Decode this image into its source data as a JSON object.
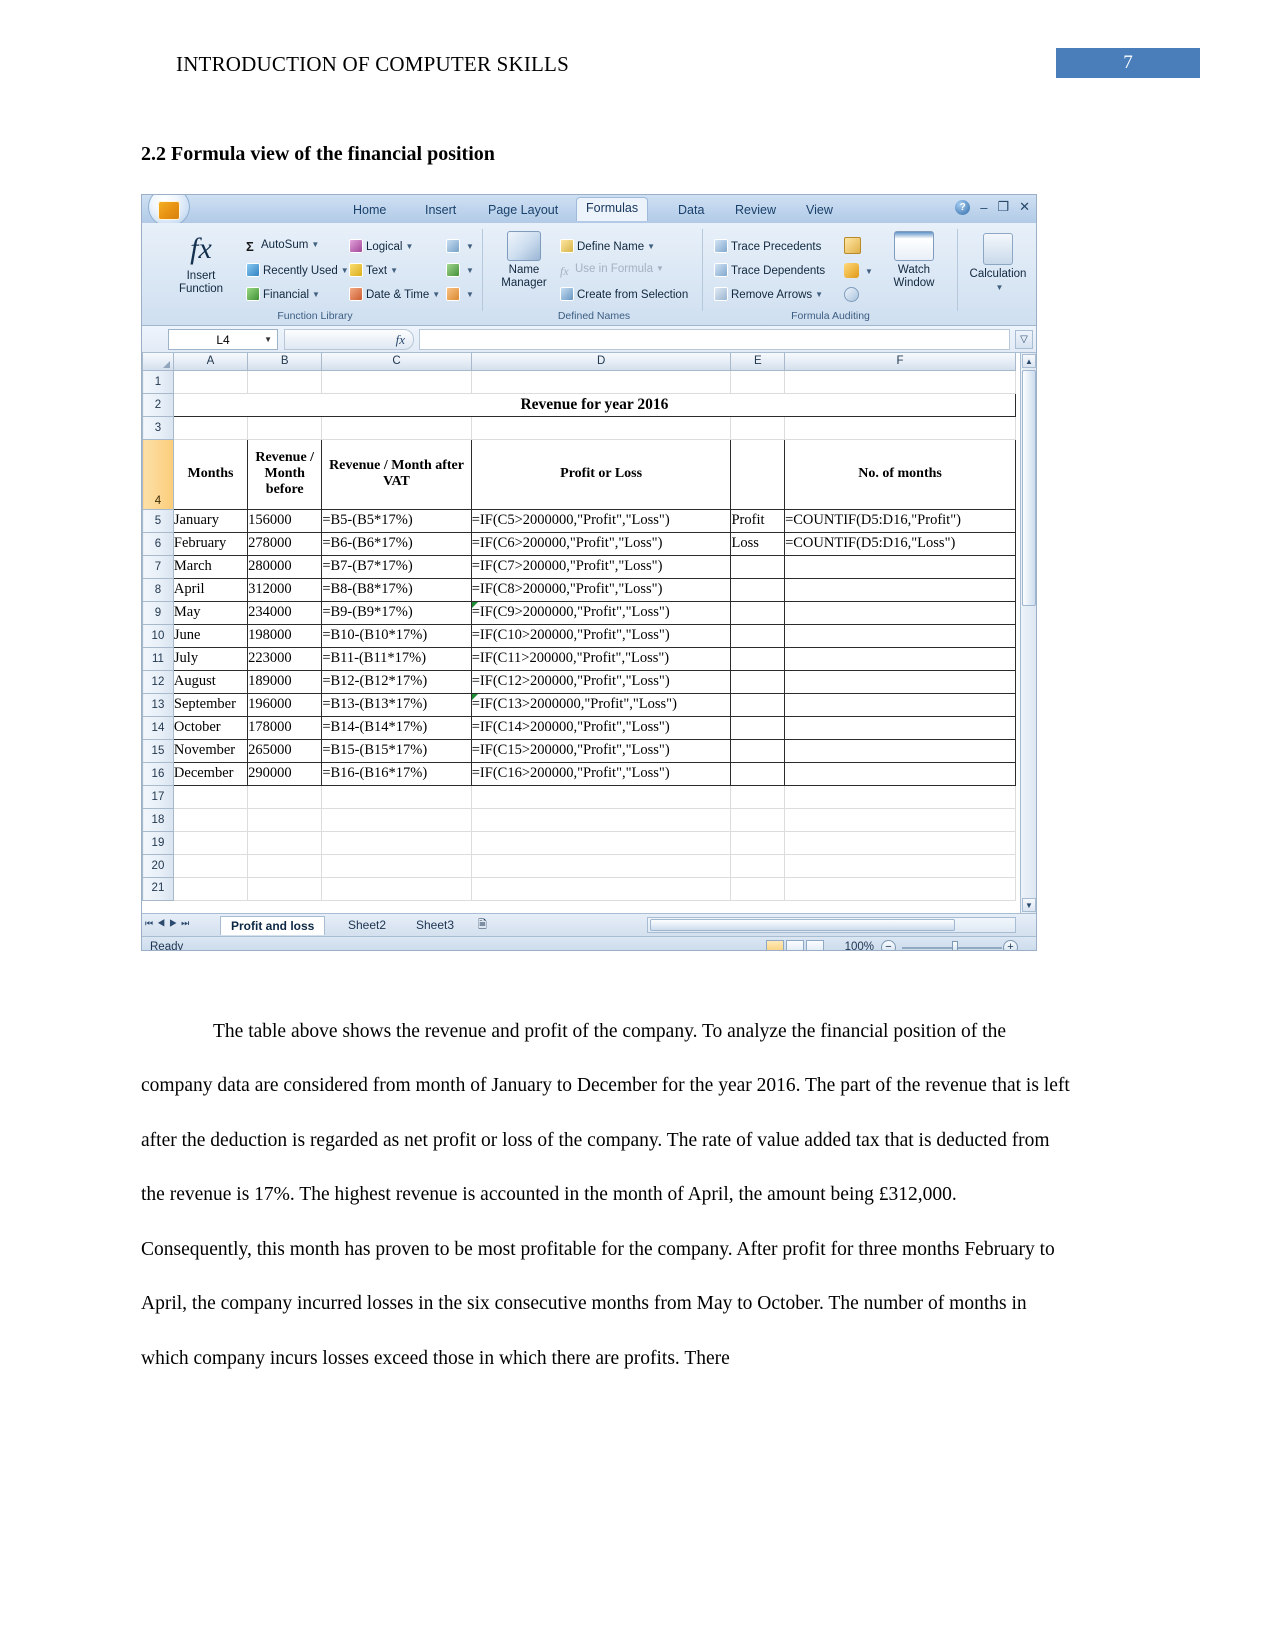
{
  "header": {
    "title": "INTRODUCTION OF COMPUTER SKILLS",
    "page_number": "7",
    "accent_color": "#4a7ebb"
  },
  "section": {
    "heading": "2.2 Formula view of the financial position"
  },
  "excel": {
    "ribbon_tabs": [
      {
        "label": "Home",
        "active": false
      },
      {
        "label": "Insert",
        "active": false
      },
      {
        "label": "Page Layout",
        "active": false
      },
      {
        "label": "Formulas",
        "active": true
      },
      {
        "label": "Data",
        "active": false
      },
      {
        "label": "Review",
        "active": false
      },
      {
        "label": "View",
        "active": false
      }
    ],
    "window_controls": {
      "help": "?",
      "minimize": "–",
      "restore": "❐",
      "close": "✕"
    },
    "groups": {
      "function_library": {
        "title": "Function Library",
        "insert_function": "Insert\nFunction",
        "insert_function_line1": "Insert",
        "insert_function_line2": "Function",
        "commands": [
          "AutoSum",
          "Recently Used",
          "Financial",
          "Logical",
          "Text",
          "Date & Time"
        ]
      },
      "defined_names": {
        "title": "Defined Names",
        "name_manager_line1": "Name",
        "name_manager_line2": "Manager",
        "commands": [
          "Define Name",
          "Use in Formula",
          "Create from Selection"
        ]
      },
      "formula_auditing": {
        "title": "Formula Auditing",
        "commands": [
          "Trace Precedents",
          "Trace Dependents",
          "Remove Arrows"
        ],
        "watch_window_line1": "Watch",
        "watch_window_line2": "Window"
      },
      "calculation": {
        "title": "",
        "label": "Calculation"
      }
    },
    "formula_bar": {
      "name_box": "L4",
      "fx_glyph": "fx",
      "value": ""
    },
    "column_headers": [
      "A",
      "B",
      "C",
      "D",
      "E",
      "F"
    ],
    "row_numbers": [
      "1",
      "2",
      "3",
      "4",
      "5",
      "6",
      "7",
      "8",
      "9",
      "10",
      "11",
      "12",
      "13",
      "14",
      "15",
      "16",
      "17",
      "18",
      "19",
      "20",
      "21"
    ],
    "selected_row": "4",
    "sheet_title": "Revenue for year 2016",
    "table_headers": {
      "months": "Months",
      "revenue_before": "Revenue / Month before",
      "revenue_after_vat": "Revenue / Month after VAT",
      "profit_or_loss": "Profit or Loss",
      "e_blank": "",
      "no_of_months": "No. of months"
    },
    "rows": [
      {
        "row": "5",
        "month": "January",
        "revenue": "156000",
        "vat_formula": "=B5-(B5*17%)",
        "pl_formula": "=IF(C5>2000000,\"Profit\",\"Loss\")",
        "e": "Profit",
        "f": "=COUNTIF(D5:D16,\"Profit\")",
        "err": false
      },
      {
        "row": "6",
        "month": "February",
        "revenue": "278000",
        "vat_formula": "=B6-(B6*17%)",
        "pl_formula": "=IF(C6>200000,\"Profit\",\"Loss\")",
        "e": "Loss",
        "f": "=COUNTIF(D5:D16,\"Loss\")",
        "err": false
      },
      {
        "row": "7",
        "month": "March",
        "revenue": "280000",
        "vat_formula": "=B7-(B7*17%)",
        "pl_formula": "=IF(C7>200000,\"Profit\",\"Loss\")",
        "e": "",
        "f": "",
        "err": false
      },
      {
        "row": "8",
        "month": "April",
        "revenue": "312000",
        "vat_formula": "=B8-(B8*17%)",
        "pl_formula": "=IF(C8>200000,\"Profit\",\"Loss\")",
        "e": "",
        "f": "",
        "err": false
      },
      {
        "row": "9",
        "month": "May",
        "revenue": "234000",
        "vat_formula": "=B9-(B9*17%)",
        "pl_formula": "=IF(C9>2000000,\"Profit\",\"Loss\")",
        "e": "",
        "f": "",
        "err": true
      },
      {
        "row": "10",
        "month": "June",
        "revenue": "198000",
        "vat_formula": "=B10-(B10*17%)",
        "pl_formula": "=IF(C10>200000,\"Profit\",\"Loss\")",
        "e": "",
        "f": "",
        "err": false
      },
      {
        "row": "11",
        "month": "July",
        "revenue": "223000",
        "vat_formula": "=B11-(B11*17%)",
        "pl_formula": "=IF(C11>200000,\"Profit\",\"Loss\")",
        "e": "",
        "f": "",
        "err": false
      },
      {
        "row": "12",
        "month": "August",
        "revenue": "189000",
        "vat_formula": "=B12-(B12*17%)",
        "pl_formula": "=IF(C12>200000,\"Profit\",\"Loss\")",
        "e": "",
        "f": "",
        "err": false
      },
      {
        "row": "13",
        "month": "September",
        "revenue": "196000",
        "vat_formula": "=B13-(B13*17%)",
        "pl_formula": "=IF(C13>2000000,\"Profit\",\"Loss\")",
        "e": "",
        "f": "",
        "err": true
      },
      {
        "row": "14",
        "month": "October",
        "revenue": "178000",
        "vat_formula": "=B14-(B14*17%)",
        "pl_formula": "=IF(C14>200000,\"Profit\",\"Loss\")",
        "e": "",
        "f": "",
        "err": false
      },
      {
        "row": "15",
        "month": "November",
        "revenue": "265000",
        "vat_formula": "=B15-(B15*17%)",
        "pl_formula": "=IF(C15>200000,\"Profit\",\"Loss\")",
        "e": "",
        "f": "",
        "err": false
      },
      {
        "row": "16",
        "month": "December",
        "revenue": "290000",
        "vat_formula": "=B16-(B16*17%)",
        "pl_formula": "=IF(C16>200000,\"Profit\",\"Loss\")",
        "e": "",
        "f": "",
        "err": false
      }
    ],
    "sheet_tabs": [
      {
        "label": "Profit and loss",
        "active": true
      },
      {
        "label": "Sheet2",
        "active": false
      },
      {
        "label": "Sheet3",
        "active": false
      }
    ],
    "status_bar": {
      "status": "Ready",
      "zoom": "100%",
      "zoom_out": "−",
      "zoom_in": "+"
    }
  },
  "body": {
    "paragraph": "The table above shows the revenue and profit of the company. To analyze the financial position of the company data are considered from month of January to December for the year 2016. The part of the revenue that is left after the deduction is regarded as net profit or loss of the company. The rate of value added tax that is deducted from the revenue is 17%. The highest revenue is accounted in the month of April, the amount being £312,000. Consequently, this month has proven to be most profitable for the company. After profit for three months February to April, the company incurred losses in the six consecutive months from May to October. The number of months in which company incurs losses exceed those in which there are profits. There"
  }
}
